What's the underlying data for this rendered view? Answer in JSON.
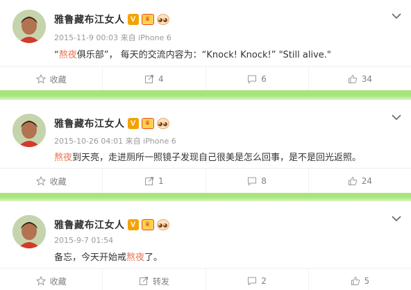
{
  "posts": [
    {
      "author": "雅鲁藏布江女人",
      "v_badge": "V",
      "meta": "2015-11-9 00:03 来自 iPhone 6",
      "text_before": "“",
      "highlight": "熬夜",
      "text_after": "俱乐部”， 每天的交流内容为：“Knock! Knock!” \"Still alive.\"",
      "actions": {
        "favorite": "收藏",
        "repost": "4",
        "comment": "6",
        "like": "34"
      }
    },
    {
      "author": "雅鲁藏布江女人",
      "v_badge": "V",
      "meta": "2015-10-26 04:01 来自 iPhone 6",
      "text_before": "",
      "highlight": "熬夜",
      "text_after": "到天亮，走进厕所一照镜子发现自己很美是怎么回事，是不是回光返照。",
      "actions": {
        "favorite": "收藏",
        "repost": "1",
        "comment": "8",
        "like": "24"
      }
    },
    {
      "author": "雅鲁藏布江女人",
      "v_badge": "V",
      "meta": "2015-9-7 01:54",
      "text_before": "备忘，今天开始戒",
      "highlight": "熬夜",
      "text_after": "了。",
      "actions": {
        "favorite": "收藏",
        "repost": "转发",
        "comment": "2",
        "like": "5"
      }
    }
  ],
  "colors": {
    "highlight": "#eb7350",
    "separator_green": "#a7e57a",
    "vip_orange": "#f3a300"
  },
  "icons": [
    "star-icon",
    "repost-icon",
    "comment-icon",
    "thumbs-up-icon",
    "chevron-down-icon",
    "bikes-decoration-icon"
  ]
}
